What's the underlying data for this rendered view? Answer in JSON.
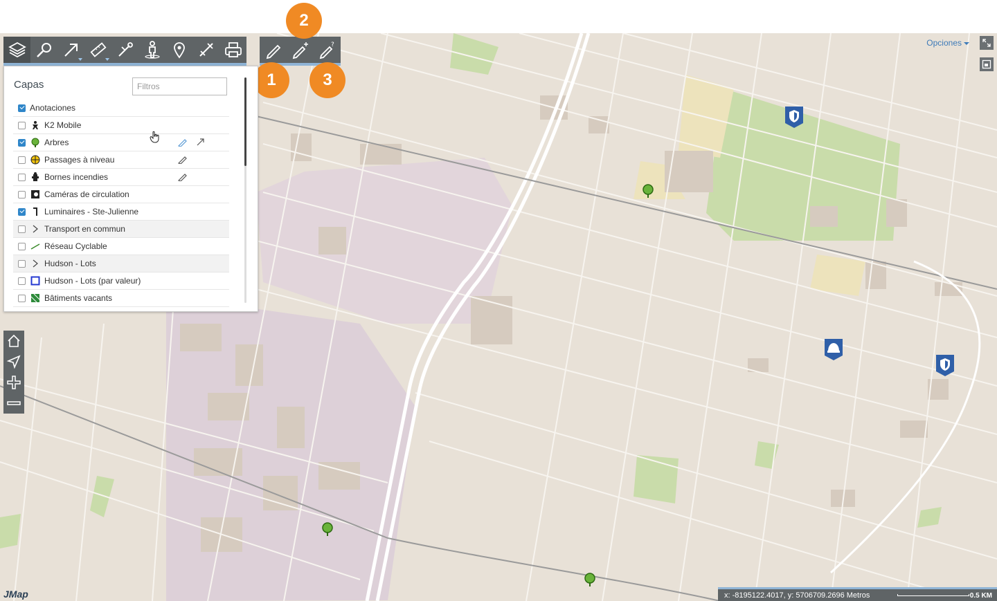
{
  "toolbar": {
    "main_tools": [
      "layers-icon",
      "search-icon",
      "select-icon",
      "measure-icon",
      "route-icon",
      "streetview-icon",
      "location-pin-icon",
      "tools-icon",
      "print-icon"
    ],
    "edit_tools": [
      "edit-pencil-icon",
      "add-feature-icon",
      "edit-query-icon"
    ]
  },
  "callouts": {
    "one": "1",
    "two": "2",
    "three": "3"
  },
  "layers_panel": {
    "title": "Capas",
    "filter_placeholder": "Filtros",
    "items": [
      {
        "label": "Anotaciones",
        "checked": true,
        "icon": "none"
      },
      {
        "label": "K2 Mobile",
        "checked": false,
        "icon": "person-icon"
      },
      {
        "label": "Arbres",
        "checked": true,
        "icon": "tree-icon"
      },
      {
        "label": "Passages à niveau",
        "checked": false,
        "icon": "crossing-icon"
      },
      {
        "label": "Bornes incendies",
        "checked": false,
        "icon": "hydrant-icon"
      },
      {
        "label": "Caméras de circulation",
        "checked": false,
        "icon": "camera-icon"
      },
      {
        "label": "Luminaires - Ste-Julienne",
        "checked": true,
        "icon": "streetlight-icon"
      },
      {
        "label": "Transport en commun",
        "checked": false,
        "icon": "chevron-right-icon"
      },
      {
        "label": "Réseau Cyclable",
        "checked": false,
        "icon": "line-icon"
      },
      {
        "label": "Hudson - Lots",
        "checked": false,
        "icon": "chevron-right-icon"
      },
      {
        "label": "Hudson - Lots (par valeur)",
        "checked": false,
        "icon": "square-icon"
      },
      {
        "label": "Bâtiments vacants",
        "checked": false,
        "icon": "hatched-icon"
      }
    ]
  },
  "map": {
    "options_label": "Opciones",
    "coordinates": "x: -8195122.4017, y: 5706709.2696 Metros",
    "scale_label": "0.5 KM",
    "logo": "JMap"
  },
  "colors": {
    "toolbar_bg": "#5f6466",
    "accent": "#f08a24",
    "checkbox": "#2f86c9"
  }
}
